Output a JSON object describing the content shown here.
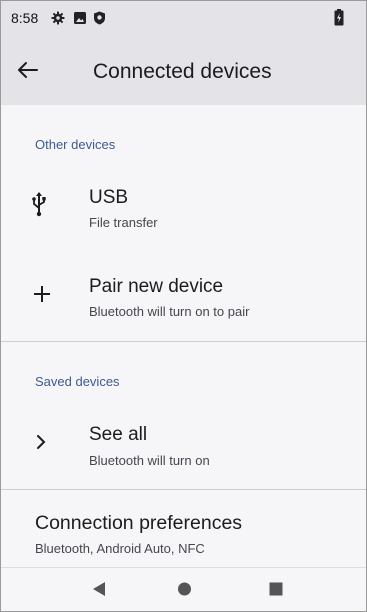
{
  "status_bar": {
    "time": "8:58",
    "icons": [
      "settings-gear-icon",
      "photo-icon",
      "shield-icon",
      "battery-charging-icon"
    ]
  },
  "app_bar": {
    "title": "Connected devices",
    "back_icon": "arrow-back-icon"
  },
  "other_devices": {
    "header": "Other devices",
    "items": [
      {
        "icon": "usb-icon",
        "title": "USB",
        "subtitle": "File transfer"
      },
      {
        "icon": "plus-icon",
        "title": "Pair new device",
        "subtitle": "Bluetooth will turn on to pair"
      }
    ]
  },
  "saved_devices": {
    "header": "Saved devices",
    "items": [
      {
        "icon": "chevron-right-icon",
        "title": "See all",
        "subtitle": "Bluetooth will turn on"
      }
    ]
  },
  "connection_preferences": {
    "title": "Connection preferences",
    "subtitle": "Bluetooth, Android Auto, NFC"
  },
  "nav_bar": {
    "buttons": [
      "back-triangle-icon",
      "home-circle-icon",
      "recents-square-icon"
    ]
  },
  "colors": {
    "app_bar_bg": "#e4e3e7",
    "page_bg": "#f6f5f8",
    "section_header": "#3d5a94"
  }
}
